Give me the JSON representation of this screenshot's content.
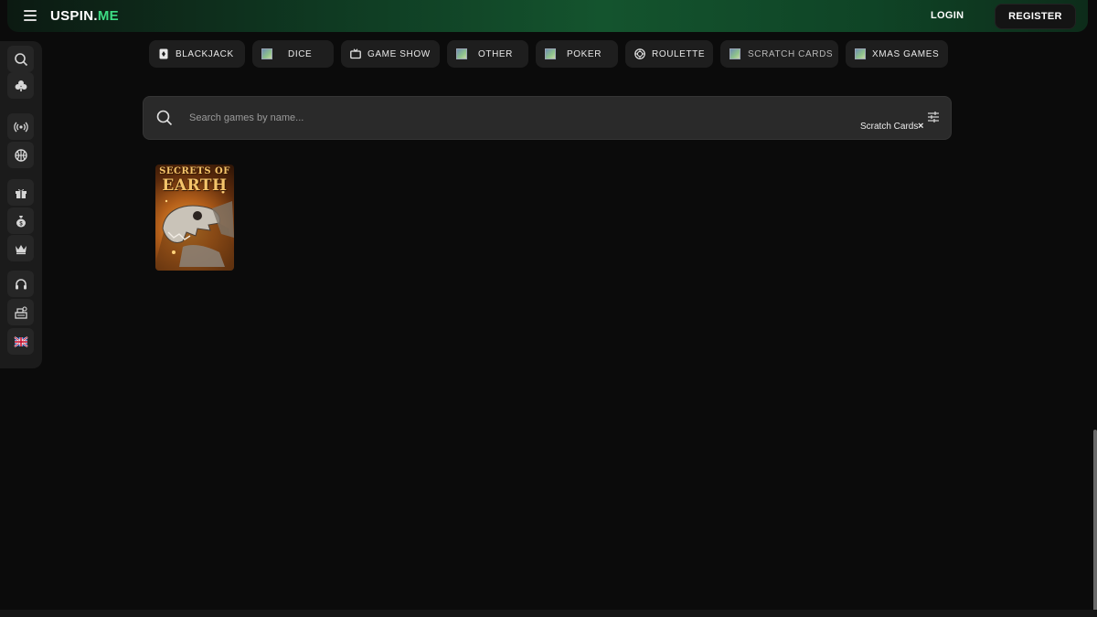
{
  "header": {
    "logo_part1": "USPIN.",
    "logo_part2": "ME",
    "login_label": "LOGIN",
    "register_label": "REGISTER"
  },
  "sidebar": {
    "items": [
      {
        "icon": "search-icon"
      },
      {
        "icon": "club-icon"
      },
      {
        "icon": "live-broadcast-icon"
      },
      {
        "icon": "basketball-icon"
      },
      {
        "icon": "gift-icon"
      },
      {
        "icon": "money-bag-icon"
      },
      {
        "icon": "crown-icon"
      },
      {
        "icon": "headset-icon"
      },
      {
        "icon": "cash-register-icon"
      },
      {
        "icon": "uk-flag-icon"
      }
    ]
  },
  "categories": [
    {
      "label": "BLACKJACK",
      "icon": "playing-card-icon"
    },
    {
      "label": "DICE",
      "icon": "image-placeholder-icon"
    },
    {
      "label": "GAME SHOW",
      "icon": "tv-icon"
    },
    {
      "label": "OTHER",
      "icon": "image-placeholder-icon"
    },
    {
      "label": "POKER",
      "icon": "image-placeholder-icon"
    },
    {
      "label": "ROULETTE",
      "icon": "roulette-icon"
    },
    {
      "label": "SCRATCH CARDS",
      "icon": "image-placeholder-icon"
    },
    {
      "label": "XMAS GAMES",
      "icon": "image-placeholder-icon"
    }
  ],
  "search": {
    "placeholder": "Search games by name...",
    "active_filter": "Scratch Cards",
    "clear_symbol": "×"
  },
  "games": [
    {
      "title_line1": "SECRETS OF",
      "title_line2": "EARTH"
    }
  ],
  "colors": {
    "accent": "#3ddc84",
    "background": "#0b0b0b",
    "header_green": "#14542e"
  }
}
